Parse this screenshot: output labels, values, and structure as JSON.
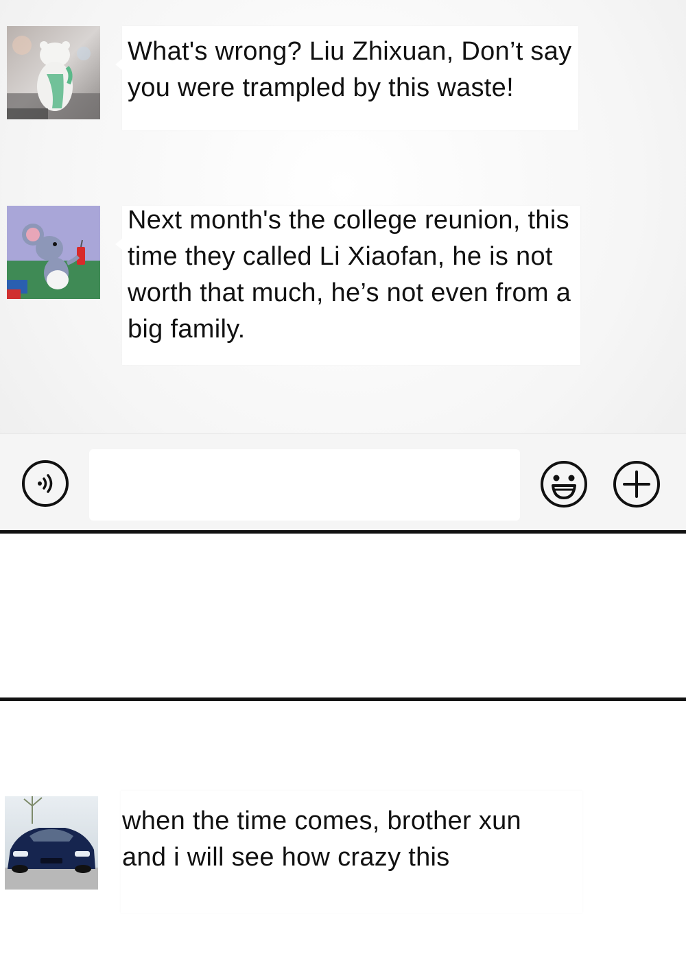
{
  "messages": [
    {
      "sender_avatar": "polar-bear-figurine-avatar",
      "text": "What's wrong? Liu Zhixuan, Don’t say you were trampled by this waste!"
    },
    {
      "sender_avatar": "cartoon-mouse-avatar",
      "text": "Next month's the college reunion, this time they called Li Xiaofan, he is not worth that much, he’s not even from a big family."
    },
    {
      "sender_avatar": "blue-sports-car-avatar",
      "text": "when the time comes, brother xun and i will see how crazy this"
    }
  ],
  "input_bar": {
    "voice_icon": "voice-icon",
    "emoji_icon": "smiley-icon",
    "more_icon": "plus-icon",
    "input_value": ""
  },
  "colors": {
    "background": "#f4f4f4",
    "bubble": "#ffffff",
    "text": "#111111",
    "divider": "#111111"
  }
}
